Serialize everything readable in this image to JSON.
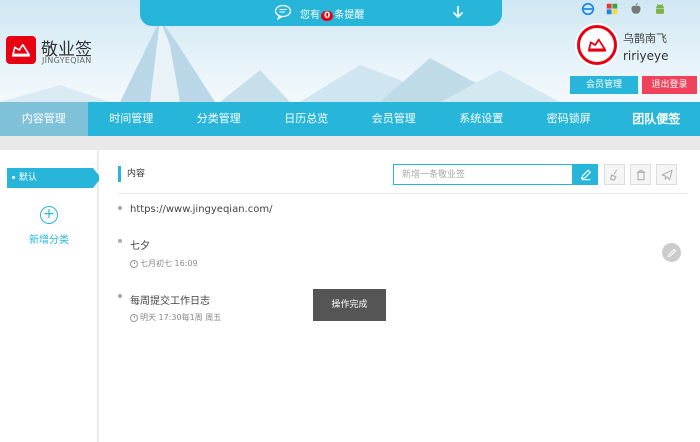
{
  "notice": {
    "prefix": "您有",
    "count": "0",
    "suffix": "条提醒"
  },
  "brand": {
    "name": "敬业签",
    "sub": "JINGYEQIAN"
  },
  "user": {
    "display_name": "乌鹊南飞",
    "username": "ririyeye"
  },
  "header_buttons": {
    "member": "会员管理",
    "logout": "退出登录"
  },
  "nav": [
    {
      "label": "内容管理"
    },
    {
      "label": "时间管理"
    },
    {
      "label": "分类管理"
    },
    {
      "label": "日历总览"
    },
    {
      "label": "会员管理"
    },
    {
      "label": "系统设置"
    },
    {
      "label": "密码锁屏"
    },
    {
      "label": "团队便签"
    }
  ],
  "sidebar": {
    "default_category": "默认",
    "add_category": "新增分类"
  },
  "content": {
    "title": "内容",
    "search_placeholder": "新增一条敬业签"
  },
  "notes": [
    {
      "text": "https://www.jingyeqian.com/",
      "time": ""
    },
    {
      "text": "七夕",
      "time": "七月初七 16:09"
    },
    {
      "text": "每周提交工作日志",
      "time": "明天 17:30每1周 周五"
    }
  ],
  "toast": "操作完成",
  "colors": {
    "accent": "#27b6d9",
    "brand_red": "#e60012",
    "logout_red": "#f0435b"
  }
}
